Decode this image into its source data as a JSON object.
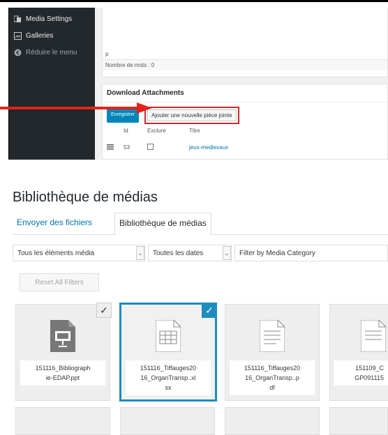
{
  "sidebar": {
    "items": [
      {
        "label": "Media Settings",
        "icon": "media-settings-icon"
      },
      {
        "label": "Galleries",
        "icon": "galleries-icon"
      },
      {
        "label": "Réduire le menu",
        "icon": "collapse-icon"
      }
    ]
  },
  "editor": {
    "path": "p",
    "word_count": "Nombre de mots : 0"
  },
  "attachments": {
    "title": "Download Attachments",
    "primary_button": "Enregistrer",
    "add_button": "Ajouter une nouvelle pièce jointe",
    "columns": [
      "Id",
      "Exclure",
      "Titre"
    ],
    "rows": [
      {
        "id": "53",
        "title": "jeux-medievaux"
      }
    ]
  },
  "media": {
    "page_title": "Bibliothèque de médias",
    "tabs": [
      "Envoyer des fichiers",
      "Bibliothèque de médias"
    ],
    "filters": {
      "type": "Tous les éléments média",
      "date": "Toutes les dates",
      "category": "Filter by Media Category"
    },
    "reset_label": "Reset All Filters",
    "tiles": [
      {
        "name": "151116_Bibliographie-EDAP.ppt",
        "line1": "151116_Bibliograph",
        "line2": "ie-EDAP.ppt",
        "line3": "",
        "checked": "gray",
        "icon": "presentation-file-icon"
      },
      {
        "name": "151116_Tiffauges2016_OrganTransp..xlsx",
        "line1": "151116_Tiffauges20",
        "line2": "16_OrganTransp..xl",
        "line3": "sx",
        "checked": "blue",
        "icon": "spreadsheet-file-icon"
      },
      {
        "name": "151116_Tiffauges2016_OrganTransp..pdf",
        "line1": "151116_Tiffauges20",
        "line2": "16_OrganTransp..p",
        "line3": "df",
        "checked": "",
        "icon": "document-file-icon"
      },
      {
        "name": "151109_C GP091115",
        "line1": "151109_C",
        "line2": "GP091115",
        "line3": "",
        "checked": "",
        "icon": "document-file-icon"
      }
    ]
  },
  "colors": {
    "wp_dark": "#23282d",
    "primary_blue": "#0085ba",
    "link_blue": "#0073aa",
    "selection_blue": "#1e8cbe",
    "highlight_red": "#d0262c"
  }
}
